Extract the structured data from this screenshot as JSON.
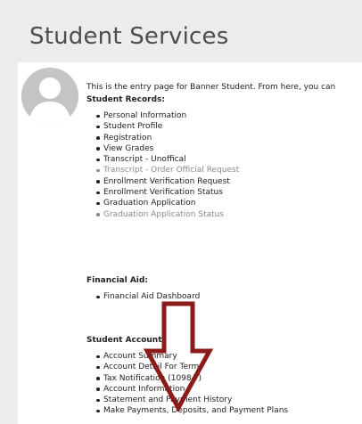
{
  "page": {
    "title": "Student Services",
    "intro": "This is the entry page for Banner Student. From here, you can"
  },
  "student_records": {
    "heading": "Student Records:",
    "items": [
      {
        "label": "Personal Information",
        "muted": false
      },
      {
        "label": "Student Profile",
        "muted": false
      },
      {
        "label": "Registration",
        "muted": false
      },
      {
        "label": "View Grades",
        "muted": false
      },
      {
        "label": "Transcript - Unoffical",
        "muted": false
      },
      {
        "label": "Transcript - Order Official Request",
        "muted": true
      },
      {
        "label": "Enrollment Verification Request",
        "muted": false
      },
      {
        "label": "Enrollment Verification Status",
        "muted": false
      },
      {
        "label": "Graduation Application",
        "muted": false
      },
      {
        "label": "Graduation Application Status",
        "muted": true
      }
    ]
  },
  "financial_aid": {
    "heading": "Financial Aid:",
    "items": [
      {
        "label": "Financial Aid Dashboard",
        "muted": false
      }
    ]
  },
  "student_account": {
    "heading": "Student Account:",
    "items": [
      {
        "label": "Account Summary",
        "muted": false
      },
      {
        "label": "Account Detail For Term",
        "muted": false
      },
      {
        "label": "Tax Notification (1098-T)",
        "muted": false
      },
      {
        "label": "Account Information",
        "muted": false
      },
      {
        "label": "Statement and Payment History",
        "muted": false
      },
      {
        "label": "Make Payments, Deposits, and Payment Plans",
        "muted": false
      }
    ]
  },
  "colors": {
    "background": "#ececec",
    "panel": "#ffffff",
    "text": "#222222",
    "muted_text": "#8a8a8a",
    "title": "#4d4d4d",
    "avatar": "#c4c4c4",
    "arrow": "#8b1a1a"
  },
  "icons": {
    "avatar": "user-silhouette-icon",
    "annotation": "down-arrow-annotation"
  }
}
